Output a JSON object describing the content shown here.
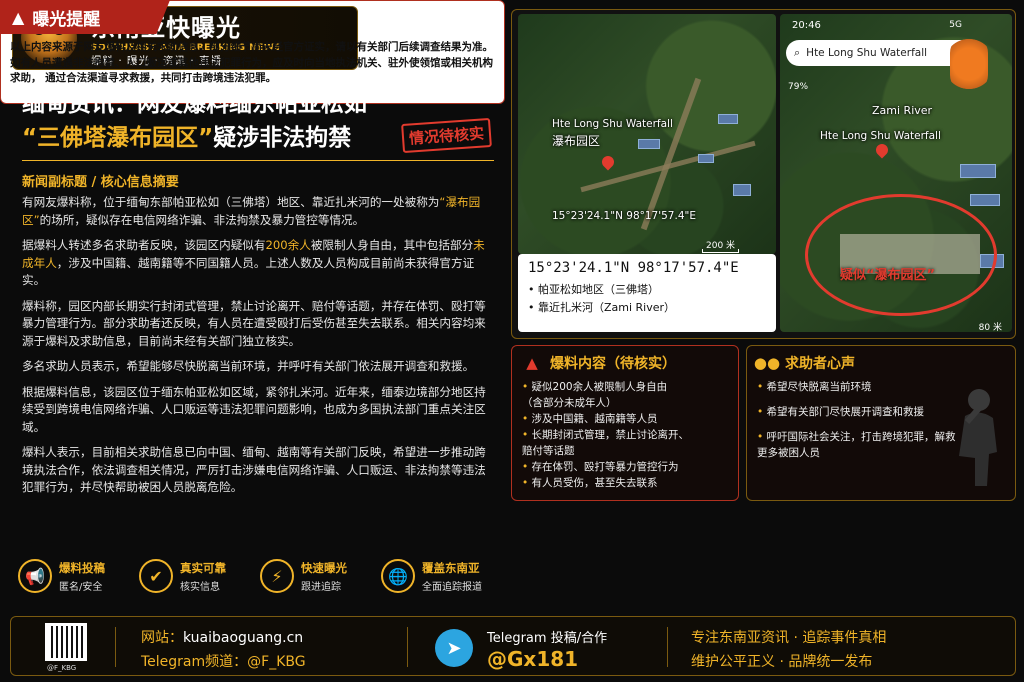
{
  "logo": {
    "name_cn": "东南亚快曝光",
    "name_en": "SOUTHEAST ASIA BREAKING NEWS",
    "tags": "爆料 · 曝光 · 资讯 · 直播"
  },
  "headline": {
    "line1": "缅甸资讯：网友爆料缅东帕亚松如",
    "line2_quote": "“三佛塔瀑布园区”",
    "line2_rest": "疑涉非法拘禁",
    "stamp": "情况待核实"
  },
  "subhead": "新闻副标题 / 核心信息摘要",
  "body": {
    "p1_a": "有网友爆料称，位于缅甸东部帕亚松如（三佛塔）地区、靠近扎米河的一处被称为",
    "p1_hl": "“瀑布园区”",
    "p1_b": "的场所，疑似存在电信网络诈骗、非法拘禁及暴力管控等情况。",
    "p2_a": "据爆料人转述多名求助者反映，该园区内疑似有",
    "p2_hl1": "200余人",
    "p2_b": "被限制人身自由，其中包括部分",
    "p2_hl2": "未成年人",
    "p2_c": "，涉及中国籍、越南籍等不同国籍人员。上述人数及人员构成目前尚未获得官方证实。",
    "p3": "爆料称，园区内部长期实行封闭式管理，禁止讨论离开、赔付等话题，并存在体罚、殴打等暴力管理行为。部分求助者还反映，有人员在遭受殴打后受伤甚至失去联系。相关内容均来源于爆料及求助信息，目前尚未经有关部门独立核实。",
    "p4": "多名求助人员表示，希望能够尽快脱离当前环境，并呼吁有关部门依法展开调查和救援。",
    "p5": "根据爆料信息，该园区位于缅东帕亚松如区域，紧邻扎米河。近年来，缅泰边境部分地区持续受到跨境电信网络诈骗、人口贩运等违法犯罪问题影响，也成为多国执法部门重点关注区域。",
    "p6": "爆料人表示，目前相关求助信息已向中国、缅甸、越南等有关部门反映，希望进一步推动跨境执法合作，依法调查相关情况，严厉打击涉嫌电信网络诈骗、人口贩运、非法拘禁等违法犯罪行为，并尽快帮助被困人员脱离危险。"
  },
  "features": [
    {
      "icon": "megaphone-icon",
      "glyph": "📢",
      "title": "爆料投稿",
      "sub": "匿名/安全"
    },
    {
      "icon": "shield-icon",
      "glyph": "✔",
      "title": "真实可靠",
      "sub": "核实信息"
    },
    {
      "icon": "lightning-icon",
      "glyph": "⚡",
      "title": "快速曝光",
      "sub": "跟进追踪"
    },
    {
      "icon": "globe-icon",
      "glyph": "🌐",
      "title": "覆盖东南亚",
      "sub": "全面追踪报道"
    }
  ],
  "map": {
    "left_label_en": "Hte Long Shu Waterfall",
    "left_label_cn": "瀑布园区",
    "left_coord": "15°23'24.1\"N 98°17'57.4\"E",
    "left_scale": "200 米",
    "coord_big": "15°23'24.1\"N 98°17'57.4\"E",
    "coord_items": [
      "帕亚松如地区（三佛塔）",
      "靠近扎米河（Zami River）"
    ],
    "phone_time": "20:46",
    "phone_status": "5G",
    "search_text": "Hte Long Shu Waterfall",
    "zoom": "79%",
    "right_label_river": "Zami River",
    "right_label_site": "Hte Long Shu Waterfall",
    "circle_label": "疑似“瀑布园区”",
    "right_scale": "80 米"
  },
  "report_box": {
    "title": "爆料内容（待核实）",
    "items": [
      {
        "text": "疑似200余人被限制人身自由",
        "indent": false
      },
      {
        "text": "（含部分未成年人）",
        "indent": true
      },
      {
        "text": "涉及中国籍、越南籍等人员",
        "indent": false
      },
      {
        "text": "长期封闭式管理，禁止讨论离开、",
        "indent": false
      },
      {
        "text": "赔付等话题",
        "indent": true
      },
      {
        "text": "存在体罚、殴打等暴力管控行为",
        "indent": false
      },
      {
        "text": "有人员受伤，甚至失去联系",
        "indent": false
      }
    ]
  },
  "voice_box": {
    "title": "求助者心声",
    "items": [
      "希望尽快脱离当前环境",
      "希望有关部门尽快展开调查和救援",
      "呼吁国际社会关注，打击跨境犯罪，解救更多被困人员"
    ]
  },
  "expose": {
    "title": "曝光提醒",
    "text": "以上内容来源于网友爆料及相关求助信息，部分细节尚未经官方证实，请以有关部门后续调查结果为准。如有人员遭遇非法拘禁、人口贩运或其他违法犯罪行为，应及时向当地执法机关、驻外使领馆或相关机构求助， 通过合法渠道寻求救援，共同打击跨境违法犯罪。"
  },
  "footer": {
    "qr_label": "@F_KBG",
    "site_label": "网站：",
    "site_url": "kuaibaoguang.cn",
    "channel": "Telegram频道：@F_KBG",
    "tg_label": "Telegram 投稿/合作",
    "tg_id": "@Gx181",
    "slogan1": "专注东南亚资讯 · 追踪事件真相",
    "slogan2": "维护公平正义 · 品牌统一发布"
  },
  "colors": {
    "accent": "#f0b429",
    "alert": "#e23b2e",
    "telegram": "#2ca5e0"
  }
}
